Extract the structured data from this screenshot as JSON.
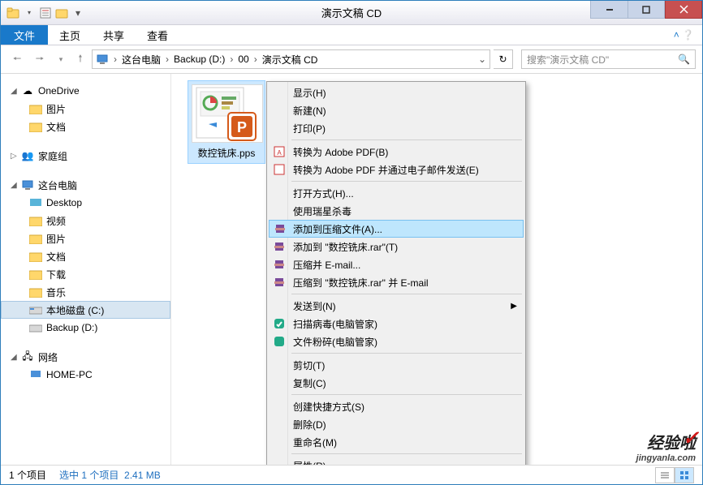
{
  "window": {
    "title": "演示文稿 CD",
    "ribbon_file": "文件",
    "ribbon_tabs": [
      "主页",
      "共享",
      "查看"
    ]
  },
  "address": {
    "segments": [
      "这台电脑",
      "Backup (D:)",
      "00",
      "演示文稿 CD"
    ],
    "search_placeholder": "搜索\"演示文稿 CD\""
  },
  "tree": {
    "onedrive": "OneDrive",
    "onedrive_children": [
      "图片",
      "文档"
    ],
    "homegroup": "家庭组",
    "thispc": "这台电脑",
    "thispc_children": [
      "Desktop",
      "视频",
      "图片",
      "文档",
      "下载",
      "音乐",
      "本地磁盘 (C:)",
      "Backup (D:)"
    ],
    "network": "网络",
    "network_children": [
      "HOME-PC"
    ]
  },
  "file": {
    "name": "数控铣床.pps"
  },
  "context_menu": {
    "items": [
      "显示(H)",
      "新建(N)",
      "打印(P)",
      "转换为 Adobe PDF(B)",
      "转换为 Adobe PDF 并通过电子邮件发送(E)",
      "打开方式(H)...",
      "使用瑞星杀毒",
      "添加到压缩文件(A)...",
      "添加到 \"数控铣床.rar\"(T)",
      "压缩并 E-mail...",
      "压缩到 \"数控铣床.rar\" 并 E-mail",
      "发送到(N)",
      "扫描病毒(电脑管家)",
      "文件粉碎(电脑管家)",
      "剪切(T)",
      "复制(C)",
      "创建快捷方式(S)",
      "删除(D)",
      "重命名(M)",
      "属性(R)"
    ]
  },
  "status": {
    "count": "1 个项目",
    "selection": "选中 1 个项目",
    "size": "2.41 MB"
  },
  "watermark": {
    "l1": "经验啦",
    "l2": "jingyanla.com"
  }
}
